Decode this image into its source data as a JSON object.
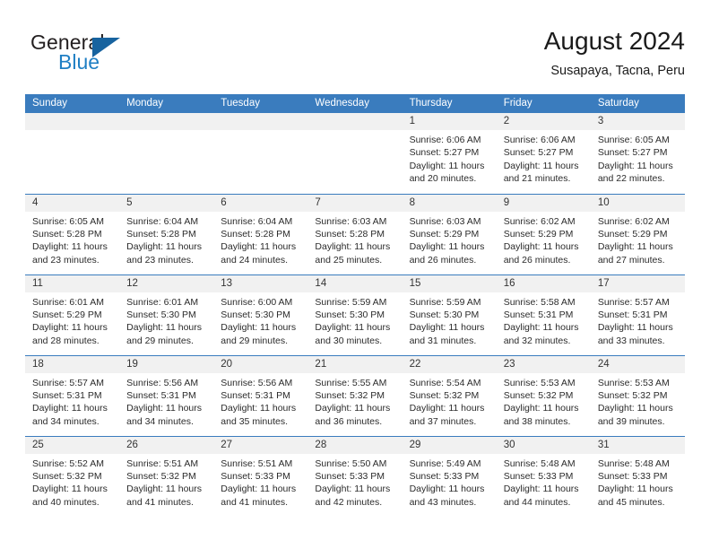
{
  "brand": {
    "name_part1": "General",
    "name_part2": "Blue",
    "triangle_icon": "blue-triangle-logo-mark",
    "colors": {
      "dark": "#231f20",
      "blue": "#1f7fc4",
      "triangle": "#17639f"
    }
  },
  "header": {
    "title": "August 2024",
    "location": "Susapaya, Tacna, Peru"
  },
  "theme": {
    "header_row_bg": "#3a7cbe",
    "daynum_bg": "#f1f1f1",
    "page_bg": "#ffffff",
    "text": "#2b2b2b"
  },
  "weekdays": [
    "Sunday",
    "Monday",
    "Tuesday",
    "Wednesday",
    "Thursday",
    "Friday",
    "Saturday"
  ],
  "weeks": [
    [
      {
        "day": "",
        "sunrise": "",
        "sunset": "",
        "daylight1": "",
        "daylight2": ""
      },
      {
        "day": "",
        "sunrise": "",
        "sunset": "",
        "daylight1": "",
        "daylight2": ""
      },
      {
        "day": "",
        "sunrise": "",
        "sunset": "",
        "daylight1": "",
        "daylight2": ""
      },
      {
        "day": "",
        "sunrise": "",
        "sunset": "",
        "daylight1": "",
        "daylight2": ""
      },
      {
        "day": "1",
        "sunrise": "Sunrise: 6:06 AM",
        "sunset": "Sunset: 5:27 PM",
        "daylight1": "Daylight: 11 hours",
        "daylight2": "and 20 minutes."
      },
      {
        "day": "2",
        "sunrise": "Sunrise: 6:06 AM",
        "sunset": "Sunset: 5:27 PM",
        "daylight1": "Daylight: 11 hours",
        "daylight2": "and 21 minutes."
      },
      {
        "day": "3",
        "sunrise": "Sunrise: 6:05 AM",
        "sunset": "Sunset: 5:27 PM",
        "daylight1": "Daylight: 11 hours",
        "daylight2": "and 22 minutes."
      }
    ],
    [
      {
        "day": "4",
        "sunrise": "Sunrise: 6:05 AM",
        "sunset": "Sunset: 5:28 PM",
        "daylight1": "Daylight: 11 hours",
        "daylight2": "and 23 minutes."
      },
      {
        "day": "5",
        "sunrise": "Sunrise: 6:04 AM",
        "sunset": "Sunset: 5:28 PM",
        "daylight1": "Daylight: 11 hours",
        "daylight2": "and 23 minutes."
      },
      {
        "day": "6",
        "sunrise": "Sunrise: 6:04 AM",
        "sunset": "Sunset: 5:28 PM",
        "daylight1": "Daylight: 11 hours",
        "daylight2": "and 24 minutes."
      },
      {
        "day": "7",
        "sunrise": "Sunrise: 6:03 AM",
        "sunset": "Sunset: 5:28 PM",
        "daylight1": "Daylight: 11 hours",
        "daylight2": "and 25 minutes."
      },
      {
        "day": "8",
        "sunrise": "Sunrise: 6:03 AM",
        "sunset": "Sunset: 5:29 PM",
        "daylight1": "Daylight: 11 hours",
        "daylight2": "and 26 minutes."
      },
      {
        "day": "9",
        "sunrise": "Sunrise: 6:02 AM",
        "sunset": "Sunset: 5:29 PM",
        "daylight1": "Daylight: 11 hours",
        "daylight2": "and 26 minutes."
      },
      {
        "day": "10",
        "sunrise": "Sunrise: 6:02 AM",
        "sunset": "Sunset: 5:29 PM",
        "daylight1": "Daylight: 11 hours",
        "daylight2": "and 27 minutes."
      }
    ],
    [
      {
        "day": "11",
        "sunrise": "Sunrise: 6:01 AM",
        "sunset": "Sunset: 5:29 PM",
        "daylight1": "Daylight: 11 hours",
        "daylight2": "and 28 minutes."
      },
      {
        "day": "12",
        "sunrise": "Sunrise: 6:01 AM",
        "sunset": "Sunset: 5:30 PM",
        "daylight1": "Daylight: 11 hours",
        "daylight2": "and 29 minutes."
      },
      {
        "day": "13",
        "sunrise": "Sunrise: 6:00 AM",
        "sunset": "Sunset: 5:30 PM",
        "daylight1": "Daylight: 11 hours",
        "daylight2": "and 29 minutes."
      },
      {
        "day": "14",
        "sunrise": "Sunrise: 5:59 AM",
        "sunset": "Sunset: 5:30 PM",
        "daylight1": "Daylight: 11 hours",
        "daylight2": "and 30 minutes."
      },
      {
        "day": "15",
        "sunrise": "Sunrise: 5:59 AM",
        "sunset": "Sunset: 5:30 PM",
        "daylight1": "Daylight: 11 hours",
        "daylight2": "and 31 minutes."
      },
      {
        "day": "16",
        "sunrise": "Sunrise: 5:58 AM",
        "sunset": "Sunset: 5:31 PM",
        "daylight1": "Daylight: 11 hours",
        "daylight2": "and 32 minutes."
      },
      {
        "day": "17",
        "sunrise": "Sunrise: 5:57 AM",
        "sunset": "Sunset: 5:31 PM",
        "daylight1": "Daylight: 11 hours",
        "daylight2": "and 33 minutes."
      }
    ],
    [
      {
        "day": "18",
        "sunrise": "Sunrise: 5:57 AM",
        "sunset": "Sunset: 5:31 PM",
        "daylight1": "Daylight: 11 hours",
        "daylight2": "and 34 minutes."
      },
      {
        "day": "19",
        "sunrise": "Sunrise: 5:56 AM",
        "sunset": "Sunset: 5:31 PM",
        "daylight1": "Daylight: 11 hours",
        "daylight2": "and 34 minutes."
      },
      {
        "day": "20",
        "sunrise": "Sunrise: 5:56 AM",
        "sunset": "Sunset: 5:31 PM",
        "daylight1": "Daylight: 11 hours",
        "daylight2": "and 35 minutes."
      },
      {
        "day": "21",
        "sunrise": "Sunrise: 5:55 AM",
        "sunset": "Sunset: 5:32 PM",
        "daylight1": "Daylight: 11 hours",
        "daylight2": "and 36 minutes."
      },
      {
        "day": "22",
        "sunrise": "Sunrise: 5:54 AM",
        "sunset": "Sunset: 5:32 PM",
        "daylight1": "Daylight: 11 hours",
        "daylight2": "and 37 minutes."
      },
      {
        "day": "23",
        "sunrise": "Sunrise: 5:53 AM",
        "sunset": "Sunset: 5:32 PM",
        "daylight1": "Daylight: 11 hours",
        "daylight2": "and 38 minutes."
      },
      {
        "day": "24",
        "sunrise": "Sunrise: 5:53 AM",
        "sunset": "Sunset: 5:32 PM",
        "daylight1": "Daylight: 11 hours",
        "daylight2": "and 39 minutes."
      }
    ],
    [
      {
        "day": "25",
        "sunrise": "Sunrise: 5:52 AM",
        "sunset": "Sunset: 5:32 PM",
        "daylight1": "Daylight: 11 hours",
        "daylight2": "and 40 minutes."
      },
      {
        "day": "26",
        "sunrise": "Sunrise: 5:51 AM",
        "sunset": "Sunset: 5:32 PM",
        "daylight1": "Daylight: 11 hours",
        "daylight2": "and 41 minutes."
      },
      {
        "day": "27",
        "sunrise": "Sunrise: 5:51 AM",
        "sunset": "Sunset: 5:33 PM",
        "daylight1": "Daylight: 11 hours",
        "daylight2": "and 41 minutes."
      },
      {
        "day": "28",
        "sunrise": "Sunrise: 5:50 AM",
        "sunset": "Sunset: 5:33 PM",
        "daylight1": "Daylight: 11 hours",
        "daylight2": "and 42 minutes."
      },
      {
        "day": "29",
        "sunrise": "Sunrise: 5:49 AM",
        "sunset": "Sunset: 5:33 PM",
        "daylight1": "Daylight: 11 hours",
        "daylight2": "and 43 minutes."
      },
      {
        "day": "30",
        "sunrise": "Sunrise: 5:48 AM",
        "sunset": "Sunset: 5:33 PM",
        "daylight1": "Daylight: 11 hours",
        "daylight2": "and 44 minutes."
      },
      {
        "day": "31",
        "sunrise": "Sunrise: 5:48 AM",
        "sunset": "Sunset: 5:33 PM",
        "daylight1": "Daylight: 11 hours",
        "daylight2": "and 45 minutes."
      }
    ]
  ]
}
